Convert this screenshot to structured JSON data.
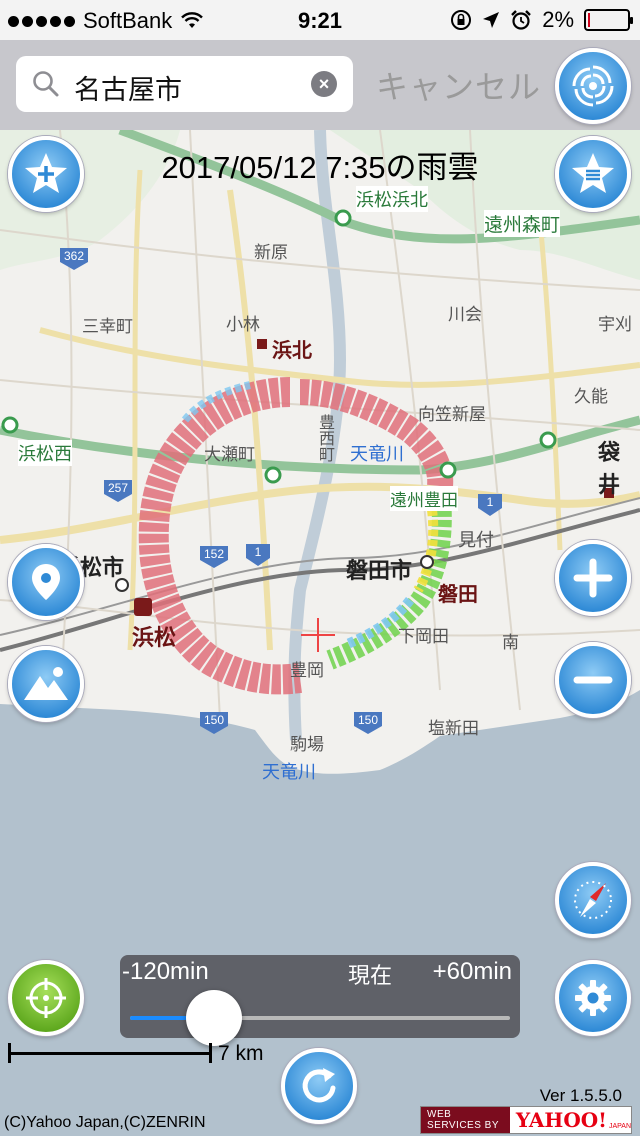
{
  "status_bar": {
    "carrier": "SoftBank",
    "time": "9:21",
    "battery": "2%",
    "signal_bars": 5
  },
  "search": {
    "value": "名古屋市",
    "cancel_label": "キャンセル"
  },
  "map": {
    "title": "2017/05/12 7:35の雨雲",
    "labels": {
      "hamakita": "浜北",
      "hamamatsu_city": "浜松市",
      "hamamatsu": "浜松",
      "iwata_city": "磐田市",
      "iwata": "磐田",
      "tenryugawa": "天竜川",
      "toyooka": "豊岡",
      "fukuroi": "袋井",
      "mitsuke": "見付",
      "shinohara": "新原",
      "komatsu": "小林",
      "sansainomachi": "三幸町",
      "kasai": "川会",
      "ennshumorimachi": "遠州森町",
      "enshutoyoda": "遠州豊田",
      "shiosinden": "塩新田",
      "komaba": "駒場",
      "hamamatsunishi": "浜松西",
      "hamamatsuhamakita": "浜松浜北",
      "ohsemachi": "大瀬町",
      "shimokanoda": "下岡田",
      "minami": "南",
      "kugano": "久能",
      "mukaikasashinya": "向笠新屋",
      "toyonishimachi": "豊西町",
      "miyoshi": "宇刈",
      "route_362": "362",
      "route_257": "257",
      "route_152": "152",
      "route_1": "1",
      "route_150": "150"
    }
  },
  "timeline": {
    "min_label": "-120min",
    "now_label": "現在",
    "max_label": "+60min",
    "position_fraction": 0.22
  },
  "scale": {
    "label": "7 km"
  },
  "footer": {
    "version": "Ver 1.5.5.0",
    "copyright": "(C)Yahoo Japan,(C)ZENRIN",
    "web_services": "WEB SERVICES BY",
    "yahoo": "YAHOO!",
    "japan": "JAPAN"
  },
  "colors": {
    "accent_blue": "#2f8ad6",
    "green_button": "#5ea81e",
    "rain_heavy": "#e0707a",
    "rain_light": "#7ec8f0",
    "rain_mid": "#6fd24a",
    "rain_yellow": "#f2e03c"
  },
  "icons": [
    "wifi-icon",
    "rotation-lock-icon",
    "location-arrow-icon",
    "alarm-icon",
    "search-icon",
    "clear-icon",
    "weather-swirl-icon",
    "add-favorite-icon",
    "favorites-list-icon",
    "current-location-icon",
    "mountain-layer-icon",
    "zoom-in-icon",
    "zoom-out-icon",
    "compass-icon",
    "settings-icon",
    "locate-me-icon",
    "refresh-icon"
  ]
}
